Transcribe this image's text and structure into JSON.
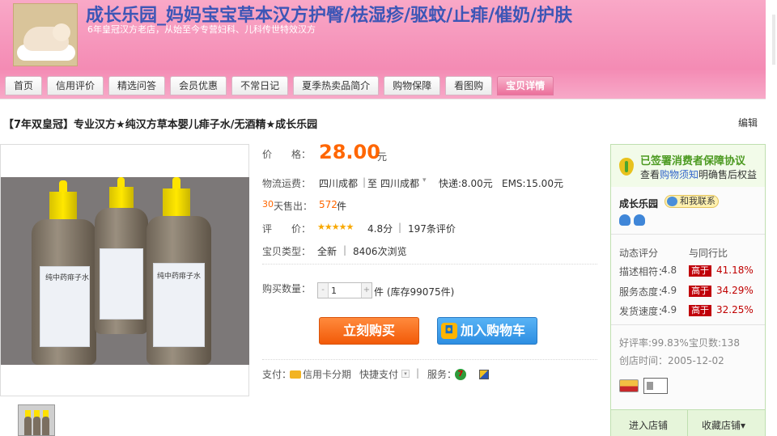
{
  "header": {
    "shop_title": "成长乐园_妈妈宝宝草本汉方护臀/祛湿疹/驱蚊/止痱/催奶/护肤",
    "shop_subtitle": "6年皇冠汉方老店，从始至今专营妇科、儿科传世特效汉方",
    "colors": {
      "banner": "#f48bb4",
      "title": "#3d56b6"
    }
  },
  "nav": {
    "tabs": [
      {
        "label": "首页"
      },
      {
        "label": "信用评价"
      },
      {
        "label": "精选问答"
      },
      {
        "label": "会员优惠"
      },
      {
        "label": "不常日记"
      },
      {
        "label": "夏季热卖品简介"
      },
      {
        "label": "购物保障"
      },
      {
        "label": "看图购"
      },
      {
        "label": "宝贝详情",
        "active": true
      }
    ]
  },
  "item": {
    "title": "【7年双皇冠】专业汉方★纯汉方草本婴儿痱子水/无酒精★成长乐园",
    "edit": "编辑",
    "image_label": "纯中药痱子水"
  },
  "info": {
    "price_label": "价　　格：",
    "price": "28.00",
    "price_unit": "元",
    "shipping_label": "物流运费：",
    "ship_from": "四川成都",
    "ship_to_prefix": "至",
    "ship_to": "四川成都",
    "express": "快递:8.00元",
    "ems": "EMS:15.00元",
    "sold_days": "30",
    "sold_label": "天售出：",
    "sold_count": "572",
    "sold_unit": "件",
    "rating_label": "评　　价：",
    "stars": "★★★★★",
    "score": "4.8分",
    "reviews": "197条评价",
    "type_label": "宝贝类型：",
    "condition": "全新",
    "views": "8406次浏览",
    "qty_label": "购买数量：",
    "qty_value": "1",
    "qty_minus": "-",
    "qty_plus": "+",
    "stock": "件 (库存99075件)",
    "buy_now": "立刻购买",
    "add_cart": "加入购物车",
    "pay_label": "支付：",
    "credit_installment": "信用卡分期",
    "quick_pay": "快捷支付",
    "service_label": "服务：",
    "service_7": "7"
  },
  "panel": {
    "guarantee_title": "已签署消费者保障协议",
    "guarantee_pre": "查看",
    "guarantee_link": "购物须知",
    "guarantee_post": "明确售后权益",
    "seller": "成长乐园",
    "contact": "和我联系",
    "dynamic_score": "动态评分",
    "compare": "与同行比",
    "scores": [
      {
        "label": "描述相符：",
        "value": "4.8",
        "badge": "高于",
        "pct": "41.18%"
      },
      {
        "label": "服务态度：",
        "value": "4.9",
        "badge": "高于",
        "pct": "34.29%"
      },
      {
        "label": "发货速度：",
        "value": "4.9",
        "badge": "高于",
        "pct": "32.25%"
      }
    ],
    "good_rate": "好评率:99.83%",
    "items_count": "宝贝数:138",
    "created": "创店时间：2005-12-02",
    "enter_shop": "进入店铺",
    "fav_shop": "收藏店铺▾"
  }
}
